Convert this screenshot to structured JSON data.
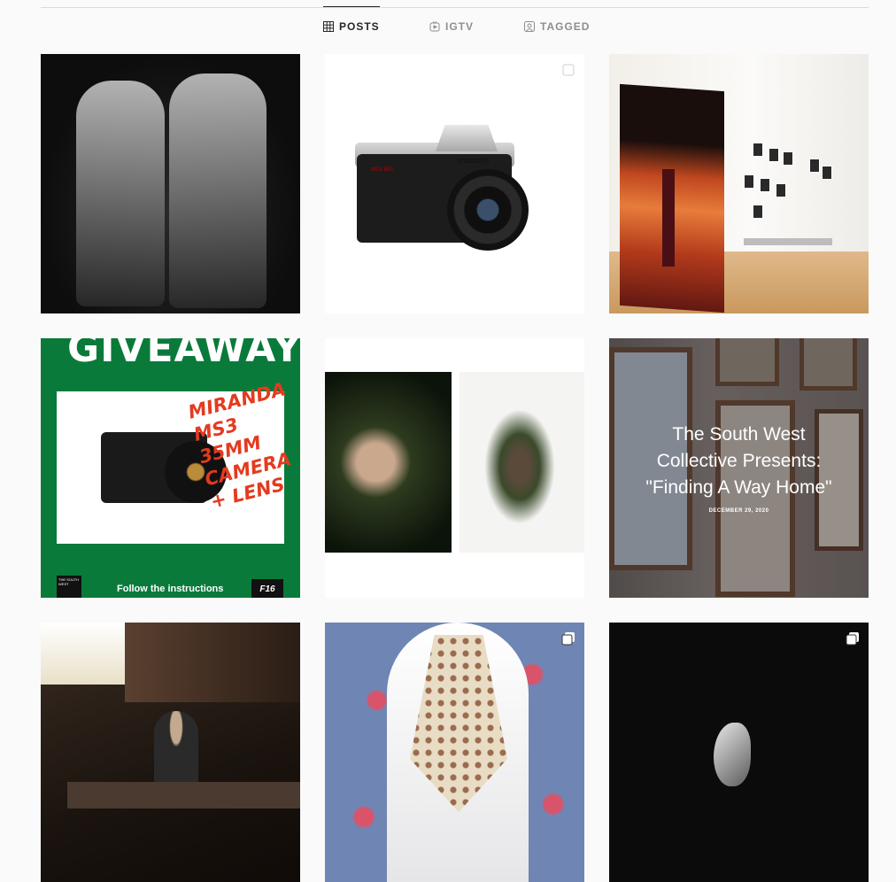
{
  "tabs": [
    {
      "label": "POSTS",
      "icon": "grid-icon",
      "active": true
    },
    {
      "label": "IGTV",
      "icon": "igtv-icon",
      "active": false
    },
    {
      "label": "TAGGED",
      "icon": "tagged-icon",
      "active": false
    }
  ],
  "posts": {
    "camera": {
      "brand": "mamiya",
      "model": "MSX 500"
    },
    "giveaway": {
      "banner": "GIVEAWAY",
      "headline_lines": [
        "MIRANDA",
        "MS3",
        "35MM",
        "CAMERA",
        "+ LENS"
      ],
      "footer": "Follow the instructions",
      "logo_text": "THE SOUTH WEST",
      "badge": "F16"
    },
    "exhibition": {
      "title_lines": [
        "The South West",
        "Collective Presents:",
        "\"Finding A Way Home\""
      ],
      "date": "DECEMBER 29, 2020"
    }
  },
  "colors": {
    "background": "#fafafa",
    "divider": "#dbdbdb",
    "active_tab": "#262626",
    "inactive_tab": "#8e8e8e",
    "giveaway_green": "#0a7a3b",
    "giveaway_red": "#e43a1f"
  }
}
